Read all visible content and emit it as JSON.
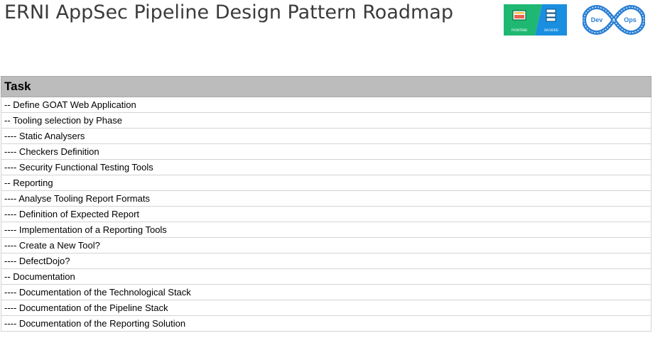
{
  "header": {
    "title": "ERNI AppSec Pipeline Design Pattern Roadmap",
    "logo_left_caption_1": "FRONTEND",
    "logo_left_caption_2": "BACKEND",
    "logo_right_word_1": "Dev",
    "logo_right_word_2": "Ops"
  },
  "colors": {
    "logo_green": "#1fb872",
    "logo_blue": "#1a8fe0",
    "devops_blue": "#2a7fd4",
    "header_gray": "#bcbcbc",
    "title_text": "#3b3b3b"
  },
  "table": {
    "header": "Task",
    "rows": [
      "-- Define GOAT Web Application",
      "-- Tooling selection by Phase",
      "---- Static Analysers",
      "---- Checkers Definition",
      "---- Security Functional Testing Tools",
      "-- Reporting",
      "---- Analyse Tooling Report Formats",
      "---- Definition of Expected Report",
      "---- Implementation of a Reporting Tools",
      "---- Create a New Tool?",
      "---- DefectDojo?",
      "-- Documentation",
      "---- Documentation of the Technological Stack",
      "---- Documentation of the Pipeline Stack",
      "---- Documentation of the Reporting Solution"
    ]
  }
}
